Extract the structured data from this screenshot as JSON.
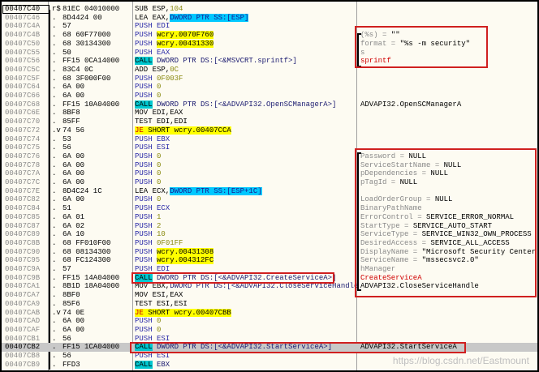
{
  "colors": {
    "call_bg": "#00c8d0",
    "jump_bg": "#ffff00",
    "highlight_box": "#d02020",
    "keyword": "#2a2aa8",
    "number": "#8a8a10",
    "selected_row": "#c8c8c8"
  },
  "watermark": "https://blog.csdn.net/Eastmount",
  "rows": [
    {
      "addr": "00407C40",
      "mark": "r$",
      "hex": "81EC 04010000",
      "asm": [
        [
          "m",
          "SUB ESP,"
        ],
        [
          "n",
          "104"
        ]
      ],
      "cmt": []
    },
    {
      "addr": "00407C46",
      "mark": ".",
      "hex": "8D4424 00",
      "asm": [
        [
          "m",
          "LEA EAX,"
        ],
        [
          "s",
          "DWORD PTR SS:[ESP]"
        ]
      ],
      "cmt": []
    },
    {
      "addr": "00407C4A",
      "mark": ".",
      "hex": "57",
      "asm": [
        [
          "p",
          "PUSH "
        ],
        [
          "p",
          "EDI"
        ]
      ],
      "cmt": []
    },
    {
      "addr": "00407C4B",
      "mark": ".",
      "hex": "68 60F77000",
      "asm": [
        [
          "p",
          "PUSH "
        ],
        [
          "y",
          "wcry.0070F760"
        ]
      ],
      "cmt": [
        [
          "g",
          "(%s) = "
        ],
        [
          "b",
          "\"\""
        ]
      ]
    },
    {
      "addr": "00407C50",
      "mark": ".",
      "hex": "68 30134300",
      "asm": [
        [
          "p",
          "PUSH "
        ],
        [
          "y",
          "wcry.00431330"
        ]
      ],
      "cmt": [
        [
          "g",
          "format = "
        ],
        [
          "b",
          "\"%s -m security\""
        ]
      ]
    },
    {
      "addr": "00407C55",
      "mark": ".",
      "hex": "50",
      "asm": [
        [
          "p",
          "PUSH "
        ],
        [
          "p",
          "EAX"
        ]
      ],
      "cmt": [
        [
          "g",
          "s"
        ]
      ]
    },
    {
      "addr": "00407C56",
      "mark": ".",
      "hex": "FF15 0CA14000",
      "asm": [
        [
          "c",
          "CALL"
        ],
        [
          "a",
          " DWORD PTR DS:[<&MSVCRT.sprintf>]"
        ]
      ],
      "cmt": [
        [
          "r",
          "sprintf"
        ]
      ]
    },
    {
      "addr": "00407C5C",
      "mark": ".",
      "hex": "83C4 0C",
      "asm": [
        [
          "m",
          "ADD ESP,"
        ],
        [
          "n",
          "0C"
        ]
      ],
      "cmt": []
    },
    {
      "addr": "00407C5F",
      "mark": ".",
      "hex": "68 3F000F00",
      "asm": [
        [
          "p",
          "PUSH "
        ],
        [
          "n",
          "0F003F"
        ]
      ],
      "cmt": []
    },
    {
      "addr": "00407C64",
      "mark": ".",
      "hex": "6A 00",
      "asm": [
        [
          "p",
          "PUSH "
        ],
        [
          "n",
          "0"
        ]
      ],
      "cmt": []
    },
    {
      "addr": "00407C66",
      "mark": ".",
      "hex": "6A 00",
      "asm": [
        [
          "p",
          "PUSH "
        ],
        [
          "n",
          "0"
        ]
      ],
      "cmt": []
    },
    {
      "addr": "00407C68",
      "mark": ".",
      "hex": "FF15 10A04000",
      "asm": [
        [
          "c",
          "CALL"
        ],
        [
          "a",
          " DWORD PTR DS:[<&ADVAPI32.OpenSCManagerA>]"
        ]
      ],
      "cmt": [
        [
          "b",
          "ADVAPI32.OpenSCManagerA"
        ]
      ]
    },
    {
      "addr": "00407C6E",
      "mark": ".",
      "hex": "8BF8",
      "asm": [
        [
          "m",
          "MOV EDI,EAX"
        ]
      ],
      "cmt": []
    },
    {
      "addr": "00407C70",
      "mark": ".",
      "hex": "85FF",
      "asm": [
        [
          "m",
          "TEST EDI,EDI"
        ]
      ],
      "cmt": []
    },
    {
      "addr": "00407C72",
      "mark": ".v",
      "hex": "74 56",
      "asm": [
        [
          "j",
          "JE"
        ],
        [
          "y",
          " SHORT wcry.00407CCA"
        ]
      ],
      "cmt": []
    },
    {
      "addr": "00407C74",
      "mark": ".",
      "hex": "53",
      "asm": [
        [
          "p",
          "PUSH EBX"
        ]
      ],
      "cmt": []
    },
    {
      "addr": "00407C75",
      "mark": ".",
      "hex": "56",
      "asm": [
        [
          "p",
          "PUSH ESI"
        ]
      ],
      "cmt": []
    },
    {
      "addr": "00407C76",
      "mark": ".",
      "hex": "6A 00",
      "asm": [
        [
          "p",
          "PUSH "
        ],
        [
          "n",
          "0"
        ]
      ],
      "cmt": [
        [
          "g",
          "Password = "
        ],
        [
          "b",
          "NULL"
        ]
      ]
    },
    {
      "addr": "00407C78",
      "mark": ".",
      "hex": "6A 00",
      "asm": [
        [
          "p",
          "PUSH "
        ],
        [
          "n",
          "0"
        ]
      ],
      "cmt": [
        [
          "g",
          "ServiceStartName = "
        ],
        [
          "b",
          "NULL"
        ]
      ]
    },
    {
      "addr": "00407C7A",
      "mark": ".",
      "hex": "6A 00",
      "asm": [
        [
          "p",
          "PUSH "
        ],
        [
          "n",
          "0"
        ]
      ],
      "cmt": [
        [
          "g",
          "pDependencies = "
        ],
        [
          "b",
          "NULL"
        ]
      ]
    },
    {
      "addr": "00407C7C",
      "mark": ".",
      "hex": "6A 00",
      "asm": [
        [
          "p",
          "PUSH "
        ],
        [
          "n",
          "0"
        ]
      ],
      "cmt": [
        [
          "g",
          "pTagId = "
        ],
        [
          "b",
          "NULL"
        ]
      ]
    },
    {
      "addr": "00407C7E",
      "mark": ".",
      "hex": "8D4C24 1C",
      "asm": [
        [
          "m",
          "LEA ECX,"
        ],
        [
          "s",
          "DWORD PTR SS:[ESP+1C]"
        ]
      ],
      "cmt": []
    },
    {
      "addr": "00407C82",
      "mark": ".",
      "hex": "6A 00",
      "asm": [
        [
          "p",
          "PUSH "
        ],
        [
          "n",
          "0"
        ]
      ],
      "cmt": [
        [
          "g",
          "LoadOrderGroup = "
        ],
        [
          "b",
          "NULL"
        ]
      ]
    },
    {
      "addr": "00407C84",
      "mark": ".",
      "hex": "51",
      "asm": [
        [
          "p",
          "PUSH ECX"
        ]
      ],
      "cmt": [
        [
          "g",
          "BinaryPathName"
        ]
      ]
    },
    {
      "addr": "00407C85",
      "mark": ".",
      "hex": "6A 01",
      "asm": [
        [
          "p",
          "PUSH "
        ],
        [
          "n",
          "1"
        ]
      ],
      "cmt": [
        [
          "g",
          "ErrorControl = "
        ],
        [
          "b",
          "SERVICE_ERROR_NORMAL"
        ]
      ]
    },
    {
      "addr": "00407C87",
      "mark": ".",
      "hex": "6A 02",
      "asm": [
        [
          "p",
          "PUSH "
        ],
        [
          "n",
          "2"
        ]
      ],
      "cmt": [
        [
          "g",
          "StartType = "
        ],
        [
          "b",
          "SERVICE_AUTO_START"
        ]
      ]
    },
    {
      "addr": "00407C89",
      "mark": ".",
      "hex": "6A 10",
      "asm": [
        [
          "p",
          "PUSH "
        ],
        [
          "n",
          "10"
        ]
      ],
      "cmt": [
        [
          "g",
          "ServiceType = "
        ],
        [
          "b",
          "SERVICE_WIN32_OWN_PROCESS"
        ]
      ]
    },
    {
      "addr": "00407C8B",
      "mark": ".",
      "hex": "68 FF010F00",
      "asm": [
        [
          "p",
          "PUSH "
        ],
        [
          "n",
          "0F01FF"
        ]
      ],
      "cmt": [
        [
          "g",
          "DesiredAccess = "
        ],
        [
          "b",
          "SERVICE_ALL_ACCESS"
        ]
      ]
    },
    {
      "addr": "00407C90",
      "mark": ".",
      "hex": "68 08134300",
      "asm": [
        [
          "p",
          "PUSH "
        ],
        [
          "y",
          "wcry.00431308"
        ]
      ],
      "cmt": [
        [
          "g",
          "DisplayName = "
        ],
        [
          "b",
          "\"Microsoft Security Center"
        ]
      ]
    },
    {
      "addr": "00407C95",
      "mark": ".",
      "hex": "68 FC124300",
      "asm": [
        [
          "p",
          "PUSH "
        ],
        [
          "y",
          "wcry.004312FC"
        ]
      ],
      "cmt": [
        [
          "g",
          "ServiceName = "
        ],
        [
          "b",
          "\"mssecsvc2.0\""
        ]
      ]
    },
    {
      "addr": "00407C9A",
      "mark": ".",
      "hex": "57",
      "asm": [
        [
          "p",
          "PUSH EDI"
        ]
      ],
      "cmt": [
        [
          "g",
          "hManager"
        ]
      ]
    },
    {
      "addr": "00407C9B",
      "mark": ".",
      "hex": "FF15 14A04000",
      "asm": [
        [
          "c",
          "CALL"
        ],
        [
          "a",
          " DWORD PTR DS:[<&ADVAPI32.CreateServiceA>]"
        ]
      ],
      "cmt": [
        [
          "r",
          "CreateServiceA"
        ]
      ]
    },
    {
      "addr": "00407CA1",
      "mark": ".",
      "hex": "8B1D 18A04000",
      "asm": [
        [
          "m",
          "MOV EBX,"
        ],
        [
          "a",
          "DWORD PTR DS:[<&ADVAPI32.CloseServiceHandle"
        ]
      ],
      "cmt": [
        [
          "b",
          "ADVAPI32.CloseServiceHandle"
        ]
      ]
    },
    {
      "addr": "00407CA7",
      "mark": ".",
      "hex": "8BF0",
      "asm": [
        [
          "m",
          "MOV ESI,EAX"
        ]
      ],
      "cmt": []
    },
    {
      "addr": "00407CA9",
      "mark": ".",
      "hex": "85F6",
      "asm": [
        [
          "m",
          "TEST ESI,ESI"
        ]
      ],
      "cmt": []
    },
    {
      "addr": "00407CAB",
      "mark": ".v",
      "hex": "74 0E",
      "asm": [
        [
          "j",
          "JE"
        ],
        [
          "y",
          " SHORT wcry.00407CBB"
        ]
      ],
      "cmt": []
    },
    {
      "addr": "00407CAD",
      "mark": ".",
      "hex": "6A 00",
      "asm": [
        [
          "p",
          "PUSH "
        ],
        [
          "n",
          "0"
        ]
      ],
      "cmt": []
    },
    {
      "addr": "00407CAF",
      "mark": ".",
      "hex": "6A 00",
      "asm": [
        [
          "p",
          "PUSH "
        ],
        [
          "n",
          "0"
        ]
      ],
      "cmt": []
    },
    {
      "addr": "00407CB1",
      "mark": ".",
      "hex": "56",
      "asm": [
        [
          "p",
          "PUSH ESI"
        ]
      ],
      "cmt": []
    },
    {
      "addr": "00407CB2",
      "mark": ".",
      "hex": "FF15 1CA04000",
      "asm": [
        [
          "c",
          "CALL"
        ],
        [
          "a",
          " DWORD PTR DS:[<&ADVAPI32.StartServiceA>]"
        ]
      ],
      "cmt": [
        [
          "b",
          "ADVAPI32.StartServiceA"
        ]
      ]
    },
    {
      "addr": "00407CB8",
      "mark": ".",
      "hex": "56",
      "asm": [
        [
          "p",
          "PUSH ESI"
        ]
      ],
      "cmt": []
    },
    {
      "addr": "00407CB9",
      "mark": ".",
      "hex": "FFD3",
      "asm": [
        [
          "c",
          "CALL"
        ],
        [
          "a",
          " EBX"
        ]
      ],
      "cmt": []
    }
  ]
}
